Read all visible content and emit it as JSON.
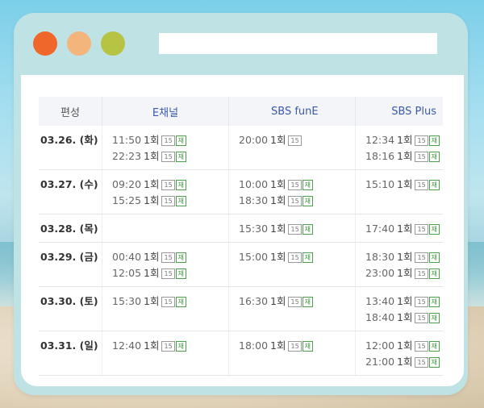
{
  "header": {
    "col0": "편성",
    "col1": "E채널",
    "col2": "SBS funE",
    "col3": "SBS Plus"
  },
  "colors": {
    "close_dot": "#f0672b",
    "minimize_dot": "#f4b57d",
    "maximize_dot": "#b6c343",
    "header_text": "#3b59a8",
    "rerun_badge": "#3a933a"
  },
  "rows": [
    {
      "date": "03.26. (화)",
      "cols": [
        [
          {
            "time": "11:50",
            "ep": "1회",
            "age": "15",
            "rerun": "재"
          },
          {
            "time": "22:23",
            "ep": "1회",
            "age": "15",
            "rerun": "재"
          }
        ],
        [
          {
            "time": "20:00",
            "ep": "1회",
            "age": "15",
            "rerun": ""
          }
        ],
        [
          {
            "time": "12:34",
            "ep": "1회",
            "age": "15",
            "rerun": "재"
          },
          {
            "time": "18:16",
            "ep": "1회",
            "age": "15",
            "rerun": "재"
          }
        ]
      ]
    },
    {
      "date": "03.27. (수)",
      "cols": [
        [
          {
            "time": "09:20",
            "ep": "1회",
            "age": "15",
            "rerun": "재"
          },
          {
            "time": "15:25",
            "ep": "1회",
            "age": "15",
            "rerun": "재"
          }
        ],
        [
          {
            "time": "10:00",
            "ep": "1회",
            "age": "15",
            "rerun": "재"
          },
          {
            "time": "18:30",
            "ep": "1회",
            "age": "15",
            "rerun": "재"
          }
        ],
        [
          {
            "time": "15:10",
            "ep": "1회",
            "age": "15",
            "rerun": "재"
          }
        ]
      ]
    },
    {
      "date": "03.28. (목)",
      "cols": [
        [],
        [
          {
            "time": "15:30",
            "ep": "1회",
            "age": "15",
            "rerun": "재"
          }
        ],
        [
          {
            "time": "17:40",
            "ep": "1회",
            "age": "15",
            "rerun": "재"
          }
        ]
      ]
    },
    {
      "date": "03.29. (금)",
      "cols": [
        [
          {
            "time": "00:40",
            "ep": "1회",
            "age": "15",
            "rerun": "재"
          },
          {
            "time": "12:05",
            "ep": "1회",
            "age": "15",
            "rerun": "재"
          }
        ],
        [
          {
            "time": "15:00",
            "ep": "1회",
            "age": "15",
            "rerun": "재"
          }
        ],
        [
          {
            "time": "18:30",
            "ep": "1회",
            "age": "15",
            "rerun": "재"
          },
          {
            "time": "23:00",
            "ep": "1회",
            "age": "15",
            "rerun": "재"
          }
        ]
      ]
    },
    {
      "date": "03.30. (토)",
      "cols": [
        [
          {
            "time": "15:30",
            "ep": "1회",
            "age": "15",
            "rerun": "재"
          }
        ],
        [
          {
            "time": "16:30",
            "ep": "1회",
            "age": "15",
            "rerun": "재"
          }
        ],
        [
          {
            "time": "13:40",
            "ep": "1회",
            "age": "15",
            "rerun": "재"
          },
          {
            "time": "18:40",
            "ep": "1회",
            "age": "15",
            "rerun": "재"
          }
        ]
      ]
    },
    {
      "date": "03.31. (일)",
      "cols": [
        [
          {
            "time": "12:40",
            "ep": "1회",
            "age": "15",
            "rerun": "재"
          }
        ],
        [
          {
            "time": "18:00",
            "ep": "1회",
            "age": "15",
            "rerun": "재"
          }
        ],
        [
          {
            "time": "12:00",
            "ep": "1회",
            "age": "15",
            "rerun": "재"
          },
          {
            "time": "21:00",
            "ep": "1회",
            "age": "15",
            "rerun": "재"
          }
        ]
      ]
    }
  ]
}
